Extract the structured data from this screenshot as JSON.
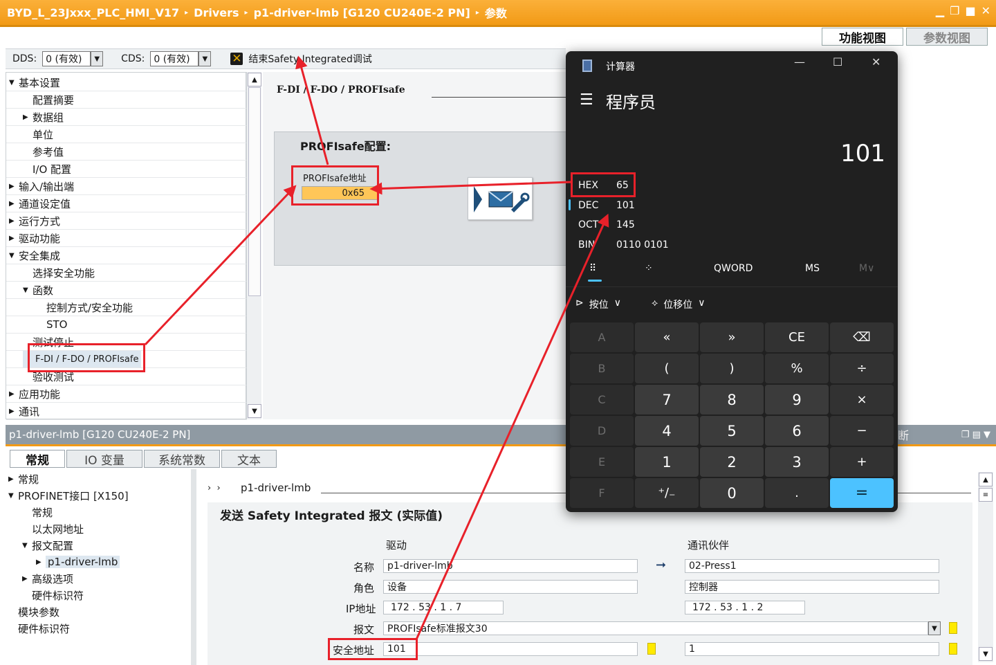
{
  "titlebar": {
    "crumbs": [
      "BYD_L_23Jxxx_PLC_HMI_V17",
      "Drivers",
      "p1-driver-lmb [G120 CU240E-2 PN]",
      "参数"
    ],
    "separator": "▸"
  },
  "view_tabs": [
    "功能视图",
    "参数视图"
  ],
  "toolbar": {
    "dds_label": "DDS:",
    "dds_value": "0 (有效)",
    "cds_label": "CDS:",
    "cds_value": "0 (有效)",
    "end_safety_label": "结束Safety Integrated调试"
  },
  "left_tree": [
    {
      "label": "基本设置",
      "level": 0,
      "toggle": "▼"
    },
    {
      "label": "配置摘要",
      "level": 1,
      "toggle": ""
    },
    {
      "label": "数据组",
      "level": 1,
      "toggle": "▶"
    },
    {
      "label": "单位",
      "level": 1,
      "toggle": ""
    },
    {
      "label": "参考值",
      "level": 1,
      "toggle": ""
    },
    {
      "label": "I/O 配置",
      "level": 1,
      "toggle": ""
    },
    {
      "label": "输入/输出端",
      "level": 0,
      "toggle": "▶"
    },
    {
      "label": "通道设定值",
      "level": 0,
      "toggle": "▶"
    },
    {
      "label": "运行方式",
      "level": 0,
      "toggle": "▶"
    },
    {
      "label": "驱动功能",
      "level": 0,
      "toggle": "▶"
    },
    {
      "label": "安全集成",
      "level": 0,
      "toggle": "▼"
    },
    {
      "label": "选择安全功能",
      "level": 1,
      "toggle": ""
    },
    {
      "label": "函数",
      "level": 1,
      "toggle": "▼"
    },
    {
      "label": "控制方式/安全功能",
      "level": 2,
      "toggle": ""
    },
    {
      "label": "STO",
      "level": 2,
      "toggle": ""
    },
    {
      "label": "测试停止",
      "level": 1,
      "toggle": ""
    },
    {
      "label": "F-DI / F-DO / PROFIsafe",
      "level": 1,
      "toggle": ""
    },
    {
      "label": "验收测试",
      "level": 1,
      "toggle": ""
    },
    {
      "label": "应用功能",
      "level": 0,
      "toggle": "▶"
    },
    {
      "label": "通讯",
      "level": 0,
      "toggle": "▶"
    }
  ],
  "main": {
    "path": "F-DI / F-DO / PROFIsafe",
    "profisafe_config_title": "PROFIsafe配置:",
    "profisafe_address_label": "PROFIsafe地址",
    "profisafe_address_value": "0x65"
  },
  "calculator": {
    "title": "计算器",
    "mode": "程序员",
    "display": "101",
    "bases": [
      {
        "key": "HEX",
        "value": "65"
      },
      {
        "key": "DEC",
        "value": "101"
      },
      {
        "key": "OCT",
        "value": "145"
      },
      {
        "key": "BIN",
        "value": "0110 0101"
      }
    ],
    "word_size": "QWORD",
    "ms": "MS",
    "mv": "M∨",
    "bitwise": "按位",
    "bitshift": "位移位",
    "keys": [
      [
        "A",
        "«",
        "»",
        "CE",
        "⌫"
      ],
      [
        "B",
        "(",
        ")",
        "%",
        "÷"
      ],
      [
        "C",
        "7",
        "8",
        "9",
        "×"
      ],
      [
        "D",
        "4",
        "5",
        "6",
        "−"
      ],
      [
        "E",
        "1",
        "2",
        "3",
        "+"
      ],
      [
        "F",
        "⁺∕₋",
        "0",
        ".",
        "="
      ]
    ]
  },
  "bottom": {
    "title": "p1-driver-lmb [G120 CU240E-2 PN]",
    "right_fragment": "断",
    "tabs": [
      "常规",
      "IO 变量",
      "系统常数",
      "文本"
    ],
    "tree": [
      {
        "label": "常规",
        "level": 0,
        "toggle": "▶"
      },
      {
        "label": "PROFINET接口 [X150]",
        "level": 0,
        "toggle": "▼"
      },
      {
        "label": "常规",
        "level": 1,
        "toggle": ""
      },
      {
        "label": "以太网地址",
        "level": 1,
        "toggle": ""
      },
      {
        "label": "报文配置",
        "level": 1,
        "toggle": "▼"
      },
      {
        "label": "p1-driver-lmb",
        "level": 2,
        "toggle": "▶"
      },
      {
        "label": "高级选项",
        "level": 1,
        "toggle": "▶"
      },
      {
        "label": "硬件标识符",
        "level": 1,
        "toggle": ""
      },
      {
        "label": "模块参数",
        "level": 0,
        "toggle": ""
      },
      {
        "label": "硬件标识符",
        "level": 0,
        "toggle": ""
      }
    ],
    "path": "p1-driver-lmb",
    "section_title": "发送 Safety Integrated 报文 (实际值)",
    "col_driver": "驱动",
    "col_partner": "通讯伙伴",
    "rows": {
      "name_label": "名称",
      "name_driver": "p1-driver-lmb",
      "name_partner": "02-Press1",
      "role_label": "角色",
      "role_driver": "设备",
      "role_partner": "控制器",
      "ip_label": "IP地址",
      "ip_driver": "172 . 53 . 1 . 7",
      "ip_partner": "172 . 53 . 1 . 2",
      "tel_label": "报文",
      "tel_value": "PROFIsafe标准报文30",
      "safety_label": "安全地址",
      "safety_driver": "101",
      "safety_partner": "1"
    }
  }
}
